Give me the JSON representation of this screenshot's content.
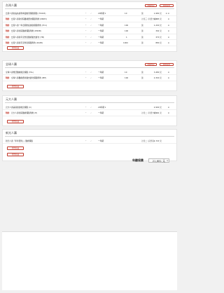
{
  "buttons": {
    "select_existing": "選擇既存",
    "create_new": "新增項目"
  },
  "sections": [
    {
      "title": "台灣人壽",
      "add_button": "新增商品",
      "rows": [
        {
          "tag": "",
          "name": "台灣人壽新長扶康利率變動型保險保險 (TU603)",
          "star": "*",
          "check": "✓",
          "option": "20年期 ▾",
          "qty": "10",
          "shop": "",
          "unit": "萬",
          "price": "1,980 元",
          "del": "⊗ ⊗"
        },
        {
          "tag": "附約",
          "name": "台灣人壽新住院醫療費用保險附約 (DN83)",
          "star": "*",
          "check": "✓",
          "option": "一年期",
          "qty": "",
          "shop": "計畫三 (新費方案) ▾",
          "unit": "",
          "price": "2,893 元",
          "del": "⊗"
        },
        {
          "tag": "附約",
          "name": "台灣人壽一年定期防癌健康保險附約 (TC1)",
          "star": "*",
          "check": "✓",
          "option": "一年期",
          "qty": "100",
          "shop": "",
          "unit": "萬",
          "price": "1,200 元",
          "del": "⊗"
        },
        {
          "tag": "附約",
          "name": "台灣人壽住院醫療保險附約 (DN9B)",
          "star": "*",
          "check": "✓",
          "option": "一年期",
          "qty": "100",
          "shop": "",
          "unit": "萬",
          "price": "392 元",
          "del": "⊗"
        },
        {
          "tag": "附約",
          "name": "台灣人壽新平安傷害醫療實支實付 (TM)",
          "star": "*",
          "check": "✓",
          "option": "一年期",
          "qty": "1",
          "shop": "",
          "unit": "萬",
          "price": "370 元",
          "del": "⊗"
        },
        {
          "tag": "附約",
          "name": "台灣人壽新平安傷害保險附約 (DA83)",
          "star": "*",
          "check": "✓",
          "option": "一年期",
          "qty": "1000",
          "shop": "",
          "unit": "萬",
          "price": "880 元",
          "del": "⊗"
        }
      ]
    },
    {
      "title": "全球人壽",
      "add_button": "新增商品",
      "rows": [
        {
          "tag": "",
          "name": "全球人壽樂活醫療終身保險 (TCL)",
          "star": "*",
          "check": "✓",
          "option": "一年期",
          "qty": "10",
          "shop": "",
          "unit": "萬",
          "price": "3,480 元",
          "del": "⊗"
        },
        {
          "tag": "附約",
          "name": "全球人壽醫療費用實支實付保險附約 (MH)",
          "star": "*",
          "check": "✓",
          "option": "一年期",
          "qty": "100",
          "shop": "",
          "unit": "萬",
          "price": "2,300 元",
          "del": "⊗"
        }
      ]
    },
    {
      "title": "元大人壽",
      "add_button": "新增商品",
      "rows": [
        {
          "tag": "",
          "name": "元大人壽美滿康壽終身保險 (C)",
          "star": "*",
          "check": "✓",
          "option": "20年期 ▾",
          "qty": "",
          "shop": "",
          "unit": "",
          "price": "2,990 元",
          "del": "⊗"
        },
        {
          "tag": "附約",
          "name": "元大人壽住院醫療保險附約 (H)",
          "star": "*",
          "check": "✓",
          "option": "一年期",
          "qty": "",
          "shop": "計畫二 (新費方案) ▾",
          "unit": "",
          "price": "2,511 元",
          "del": "⊗"
        }
      ]
    },
    {
      "title": "新光人壽",
      "add_button": "新增商品",
      "add_button_2": "新增商品",
      "rows": [
        {
          "tag": "",
          "name": "新光人壽「年年發財」」醫療保險",
          "star": "*",
          "check": "✓",
          "option": "一年期",
          "qty": "",
          "shop": "計畫二 (完整版)",
          "unit": "",
          "price": "1,722 元",
          "del": ""
        }
      ]
    }
  ],
  "total": {
    "label": "年繳保費",
    "value": "21,681 元",
    "icon": "Q"
  }
}
